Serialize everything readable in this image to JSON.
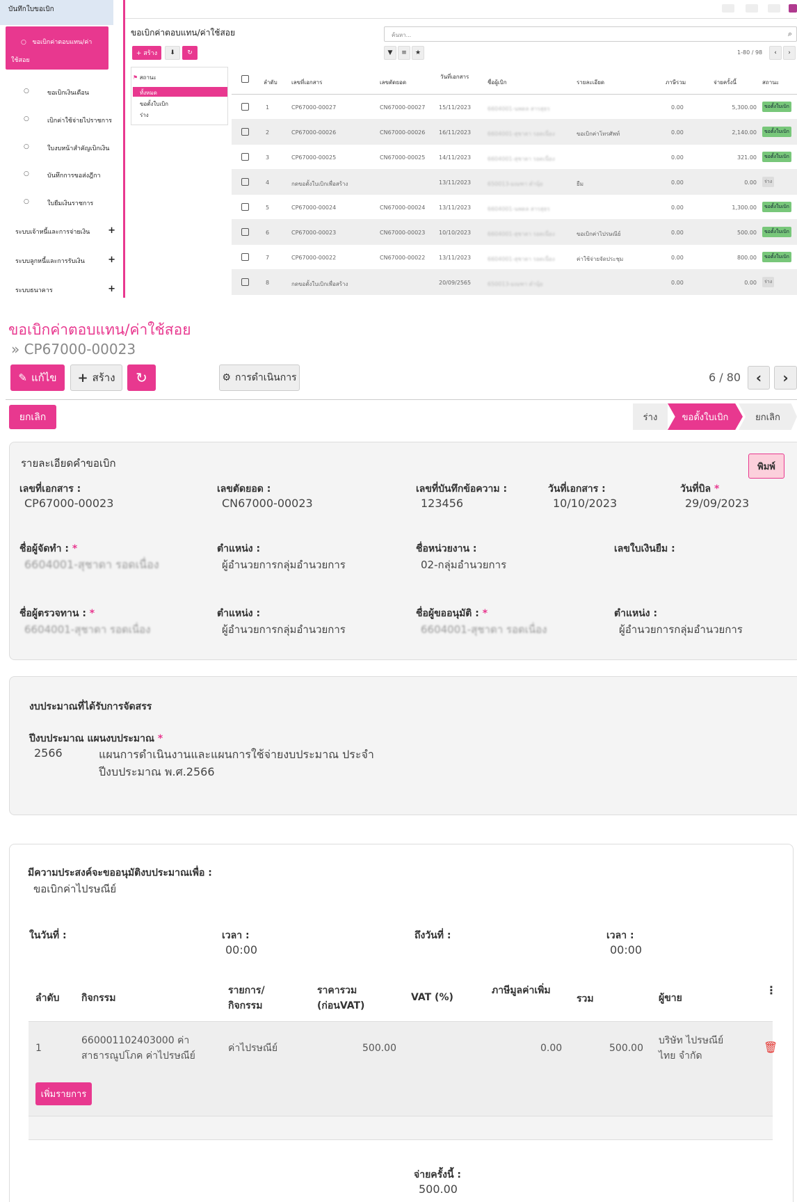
{
  "sidebar": {
    "header": "บันทึกใบขอเบิก",
    "active": "ขอเบิกค่าตอบแทน/ค่าใช้สอย",
    "items": [
      "ขอเบิกเงินเดือน",
      "เบิกค่าใช้จ่ายไปราชการ",
      "ใบงบหน้าสำคัญเบิกเงิน",
      "บันทึกการขอส่งฎีกา",
      "ใบยืมเงินราชการ"
    ],
    "groups": [
      "ระบบเจ้าหนี้และการจ่ายเงิน",
      "ระบบลูกหนี้และการรับเงิน",
      "ระบบธนาคาร"
    ]
  },
  "list": {
    "title": "ขอเบิกค่าตอบแทน/ค่าใช้สอย",
    "search_placeholder": "ค้นหา...",
    "create_label": "+ สร้าง",
    "pager": "1-80 / 98",
    "filter": {
      "title": "สถานะ",
      "options": [
        "ทั้งหมด",
        "ขอตั้งใบเบิก",
        "ร่าง"
      ]
    },
    "columns": [
      "ลำดับ",
      "เลขที่เอกสาร",
      "เลขตัดยอด",
      "วันที่เอกสาร",
      "ชื่อผู้เบิก",
      "รายละเอียด",
      "ภาษีรวม",
      "จ่ายครั้งนี้",
      "สถานะ"
    ],
    "rows": [
      {
        "no": "1",
        "doc": "CP67000-00027",
        "cut": "CN67000-00027",
        "date": "15/11/2023",
        "name": "6604001-นพดล สารสุธร",
        "detail": "",
        "tax": "0.00",
        "pay": "5,300.00",
        "status": "ขอตั้งใบเบิก"
      },
      {
        "no": "2",
        "doc": "CP67000-00026",
        "cut": "CN67000-00026",
        "date": "16/11/2023",
        "name": "6604001-สุชาดา รอดเนื่อง",
        "detail": "ขอเบิกค่าโทรศัพท์",
        "tax": "0.00",
        "pay": "2,140.00",
        "status": "ขอตั้งใบเบิก"
      },
      {
        "no": "3",
        "doc": "CP67000-00025",
        "cut": "CN67000-00025",
        "date": "14/11/2023",
        "name": "6604001-สุชาดา รอดเนื่อง",
        "detail": "",
        "tax": "0.00",
        "pay": "321.00",
        "status": "ขอตั้งใบเบิก"
      },
      {
        "no": "4",
        "doc": "กดขอตั้งใบเบิกเพื่อสร้าง",
        "cut": "",
        "date": "13/11/2023",
        "name": "650013-มณฑา ดำนุ้ย",
        "detail": "ยืม",
        "tax": "0.00",
        "pay": "0.00",
        "status": "ร่าง"
      },
      {
        "no": "5",
        "doc": "CP67000-00024",
        "cut": "CN67000-00024",
        "date": "13/11/2023",
        "name": "6604001-นพดล สารสุธร",
        "detail": "",
        "tax": "0.00",
        "pay": "1,300.00",
        "status": "ขอตั้งใบเบิก"
      },
      {
        "no": "6",
        "doc": "CP67000-00023",
        "cut": "CN67000-00023",
        "date": "10/10/2023",
        "name": "6604001-สุชาดา รอดเนื่อง",
        "detail": "ขอเบิกค่าไปรษณีย์",
        "tax": "0.00",
        "pay": "500.00",
        "status": "ขอตั้งใบเบิก"
      },
      {
        "no": "7",
        "doc": "CP67000-00022",
        "cut": "CN67000-00022",
        "date": "13/11/2023",
        "name": "6604001-สุชาดา รอดเนื่อง",
        "detail": "ค่าใช้จ่ายจัดประชุม",
        "tax": "0.00",
        "pay": "800.00",
        "status": "ขอตั้งใบเบิก"
      },
      {
        "no": "8",
        "doc": "กดขอตั้งใบเบิกเพื่อสร้าง",
        "cut": "",
        "date": "20/09/2565",
        "name": "650013-มณฑา ดำนุ้ย",
        "detail": "",
        "tax": "0.00",
        "pay": "0.00",
        "status": "ร่าง"
      }
    ]
  },
  "form": {
    "title": "ขอเบิกค่าตอบแทน/ค่าใช้สอย",
    "breadcrumb": "» CP67000-00023",
    "edit": "แก้ไข",
    "create": "สร้าง",
    "action": "การดำเนินการ",
    "pager": "6 / 80",
    "cancel": "ยกเลิก",
    "stages": [
      "ร่าง",
      "ขอตั้งใบเบิก",
      "ยกเลิก"
    ],
    "print": "พิมพ์",
    "section1": "รายละเอียดคำขอเบิก",
    "fields": [
      {
        "label": "เลขที่เอกสาร :",
        "value": "CP67000-00023"
      },
      {
        "label": "เลขตัดยอด :",
        "value": "CN67000-00023"
      },
      {
        "label": "เลขที่บันทึกข้อความ :",
        "value": "123456"
      },
      {
        "label": "วันที่เอกสาร :",
        "value": "10/10/2023"
      },
      {
        "label": "วันที่บิล",
        "value": "29/09/2023"
      },
      {
        "label": "ชื่อผู้จัดทำ :",
        "value": "6604001-สุชาดา รอดเนื่อง"
      },
      {
        "label": "ตำแหน่ง :",
        "value": "ผู้อำนวยการกลุ่มอำนวยการ"
      },
      {
        "label": "ชื่อหน่วยงาน :",
        "value": "02-กลุ่มอำนวยการ"
      },
      {
        "label": "เลขใบเงินยืม :",
        "value": ""
      },
      {
        "label": "ชื่อผู้ตรวจทาน :",
        "value": "6604001-สุชาดา รอดเนื่อง"
      },
      {
        "label": "ตำแหน่ง :",
        "value": "ผู้อำนวยการกลุ่มอำนวยการ"
      },
      {
        "label": "ชื่อผู้ขออนุมัติ :",
        "value": "6604001-สุชาดา รอดเนื่อง"
      },
      {
        "label": "ตำแหน่ง :",
        "value": "ผู้อำนวยการกลุ่มอำนวยการ"
      }
    ],
    "budget": {
      "title": "งบประมาณที่ได้รับการจัดสรร",
      "label": "ปีงบประมาณ แผนงบประมาณ",
      "year": "2566",
      "plan1": "แผนการดำเนินงานและแผนการใช้จ่ายงบประมาณ ประจำ",
      "plan2": "ปีงบประมาณ พ.ศ.2566"
    },
    "purpose": {
      "label": "มีความประสงค์จะขออนุมัติงบประมาณเพื่อ :",
      "value": "ขอเบิกค่าไปรษณีย์",
      "on_date": "ในวันที่ :",
      "time1_label": "เวลา :",
      "time1": "00:00",
      "to_date": "ถึงวันที่ :",
      "time2_label": "เวลา :",
      "time2": "00:00"
    },
    "lines": {
      "headers": {
        "no": "ลำดับ",
        "activity": "กิจกรรม",
        "item1": "รายการ/",
        "item2": "กิจกรรม",
        "price1": "ราคารวม",
        "price2": "(ก่อนVAT)",
        "vat": "VAT (%)",
        "vat_amount": "ภาษีมูลค่าเพิ่ม",
        "total": "รวม",
        "vendor": "ผู้ขาย"
      },
      "rows": [
        {
          "no": "1",
          "activity1": "660001102403000 ค่า",
          "activity2": "สาธารณูปโภค ค่าไปรษณีย์",
          "item": "ค่าไปรษณีย์",
          "price": "500.00",
          "vat_amount": "0.00",
          "total": "500.00",
          "vendor1": "บริษัท ไปรษณีย์",
          "vendor2": "ไทย จำกัด"
        }
      ],
      "add": "เพิ่มรายการ"
    },
    "pay_label": "จ่ายครั้งนี้ :",
    "pay_value": "500.00"
  },
  "colors": {
    "accent": "#e8388f",
    "badge": "#78c77a"
  }
}
